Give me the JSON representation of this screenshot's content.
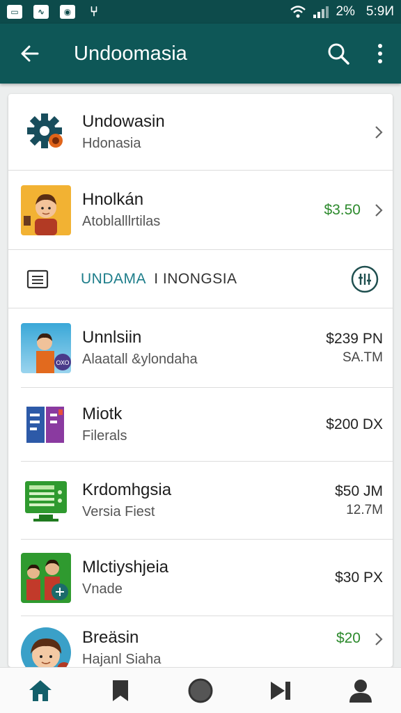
{
  "status_bar": {
    "battery": "2%",
    "time": "5:9И"
  },
  "app_bar": {
    "title": "Undoomasia"
  },
  "rows": [
    {
      "title": "Undowasin",
      "subtitle": "Hdonasia",
      "price": "",
      "meta": ""
    },
    {
      "title": "Hnolkán",
      "subtitle": "Atoblalllrtilas",
      "price": "$3.50",
      "meta": ""
    },
    {
      "title": "Unnlsiin",
      "subtitle": "Alaatall &ylondaha",
      "price": "$239 PN",
      "meta": "SA.TM"
    },
    {
      "title": "Miotk",
      "subtitle": "Filerals",
      "price": "$200 DX",
      "meta": ""
    },
    {
      "title": "Krdomhgsia",
      "subtitle": "Versia Fiest",
      "price": "$50 JM",
      "meta": "12.7M"
    },
    {
      "title": "Mlctiyshjeia",
      "subtitle": "Vnade",
      "price": "$30 PX",
      "meta": ""
    },
    {
      "title": "Breäsin",
      "subtitle": "Hajanl Siaha",
      "price": "$20",
      "meta": ""
    }
  ],
  "section": {
    "label": "UNDAMA",
    "label2": "I INONGSIA"
  },
  "colors": {
    "app_bar": "#0e5757",
    "status_bar": "#0d4b4b",
    "accent": "#1d8a8a",
    "price_green": "#2d8a2d"
  }
}
